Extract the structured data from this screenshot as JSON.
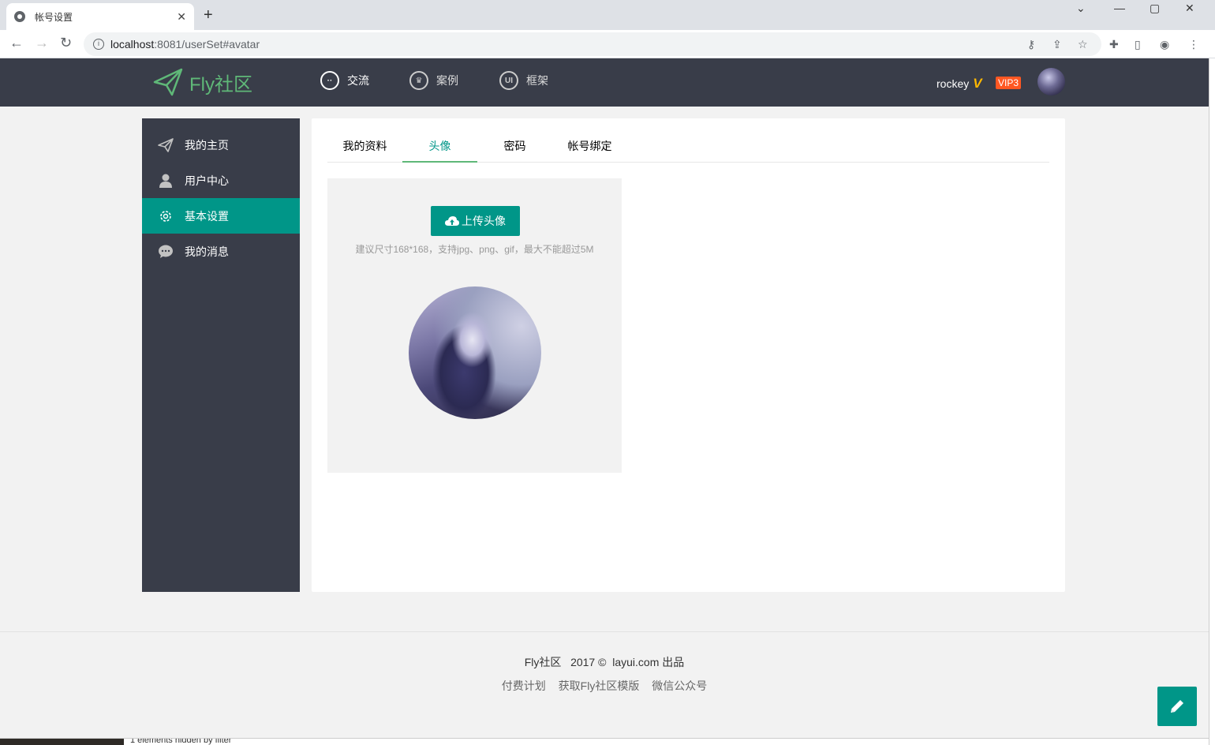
{
  "browser": {
    "tab_title": "帐号设置",
    "url_host": "localhost",
    "url_rest": ":8081/userSet#avatar"
  },
  "header": {
    "logo_text": "Fly社区",
    "nav": [
      {
        "label": "交流",
        "icon": "chat-icon"
      },
      {
        "label": "案例",
        "icon": "crown-icon"
      },
      {
        "label": "框架",
        "icon": "ui-icon"
      }
    ],
    "username": "rockey",
    "vip_badge": "VIP3"
  },
  "sidebar": {
    "items": [
      {
        "label": "我的主页",
        "icon": "paper-plane-icon",
        "active": false
      },
      {
        "label": "用户中心",
        "icon": "user-icon",
        "active": false
      },
      {
        "label": "基本设置",
        "icon": "gear-icon",
        "active": true
      },
      {
        "label": "我的消息",
        "icon": "message-icon",
        "active": false
      }
    ]
  },
  "main": {
    "tabs": [
      {
        "label": "我的资料",
        "active": false
      },
      {
        "label": "头像",
        "active": true
      },
      {
        "label": "密码",
        "active": false
      },
      {
        "label": "帐号绑定",
        "active": false
      }
    ],
    "upload_button": "上传头像",
    "hint": "建议尺寸168*168，支持jpg、png、gif，最大不能超过5M"
  },
  "footer": {
    "brand": "Fly社区",
    "year": "2017 ©",
    "site": "layui.com",
    "suffix": "出品",
    "links": [
      "付费计划",
      "获取Fly社区模版",
      "微信公众号"
    ]
  },
  "devtools": {
    "status_text": "1 elements hidden by filter"
  },
  "colors": {
    "accent": "#009688",
    "header_bg": "#393d49",
    "logo_green": "#5fb878",
    "vip": "#ff5722"
  }
}
